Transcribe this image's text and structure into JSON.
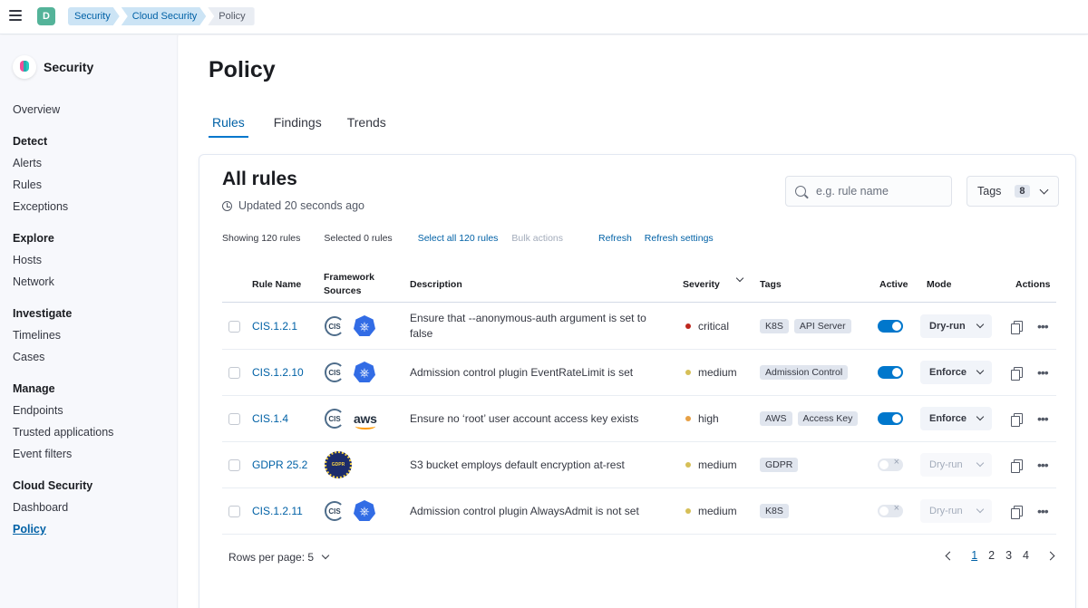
{
  "topbar": {
    "avatar_initial": "D",
    "breadcrumbs": [
      "Security",
      "Cloud Security",
      "Policy"
    ]
  },
  "sidebar": {
    "app_name": "Security",
    "overview": "Overview",
    "groups": [
      {
        "title": "Detect",
        "items": [
          "Alerts",
          "Rules",
          "Exceptions"
        ]
      },
      {
        "title": "Explore",
        "items": [
          "Hosts",
          "Network"
        ]
      },
      {
        "title": "Investigate",
        "items": [
          "Timelines",
          "Cases"
        ]
      },
      {
        "title": "Manage",
        "items": [
          "Endpoints",
          "Trusted applications",
          "Event filters"
        ]
      },
      {
        "title": "Cloud Security",
        "items": [
          "Dashboard",
          "Policy"
        ]
      }
    ],
    "active_item": "Policy"
  },
  "page": {
    "title": "Policy",
    "tabs": [
      "Rules",
      "Findings",
      "Trends"
    ],
    "active_tab": "Rules"
  },
  "panel": {
    "title": "All rules",
    "updated": "Updated 20 seconds ago",
    "search_placeholder": "e.g. rule name",
    "tags_label": "Tags",
    "tags_count": "8",
    "showing": "Showing 120 rules",
    "selected": "Selected 0 rules",
    "select_all": "Select all 120 rules",
    "bulk_actions": "Bulk actions",
    "refresh": "Refresh",
    "refresh_settings": "Refresh settings"
  },
  "table": {
    "columns": {
      "rule_name": "Rule Name",
      "framework": "Framework Sources",
      "description": "Description",
      "severity": "Severity",
      "tags": "Tags",
      "active": "Active",
      "mode": "Mode",
      "actions": "Actions"
    },
    "rows": [
      {
        "name": "CIS.1.2.1",
        "sources": [
          "cis",
          "k8s"
        ],
        "description": "Ensure that --anonymous-auth argument is set to false",
        "severity": "critical",
        "severity_color": "#bd271e",
        "tags": [
          "K8S",
          "API Server"
        ],
        "active": true,
        "mode": "Dry-run"
      },
      {
        "name": "CIS.1.2.10",
        "sources": [
          "cis",
          "k8s"
        ],
        "description": "Admission control plugin EventRateLimit is set",
        "severity": "medium",
        "severity_color": "#d6bf57",
        "tags": [
          "Admission Control"
        ],
        "active": true,
        "mode": "Enforce"
      },
      {
        "name": "CIS.1.4",
        "sources": [
          "cis",
          "aws"
        ],
        "description": "Ensure no ‘root’ user account access key exists",
        "severity": "high",
        "severity_color": "#e7a045",
        "tags": [
          "AWS",
          "Access Key"
        ],
        "active": true,
        "mode": "Enforce"
      },
      {
        "name": "GDPR 25.2",
        "sources": [
          "gdpr"
        ],
        "description": "S3 bucket employs default encryption at-rest",
        "severity": "medium",
        "severity_color": "#d6bf57",
        "tags": [
          "GDPR"
        ],
        "active": false,
        "mode": "Dry-run"
      },
      {
        "name": "CIS.1.2.11",
        "sources": [
          "cis",
          "k8s"
        ],
        "description": "Admission control plugin AlwaysAdmit is not set",
        "severity": "medium",
        "severity_color": "#d6bf57",
        "tags": [
          "K8S"
        ],
        "active": false,
        "mode": "Dry-run"
      }
    ]
  },
  "footer": {
    "rows_per_page": "Rows per page: 5",
    "pages": [
      "1",
      "2",
      "3",
      "4"
    ],
    "current_page": "1"
  },
  "logos": {
    "cis": "CIS",
    "aws": "aws",
    "gdpr": "GDPR",
    "k8s": "⎈"
  },
  "colors": {
    "accent": "#0077cc",
    "link": "#0061a6",
    "avatar": "#54b399"
  }
}
